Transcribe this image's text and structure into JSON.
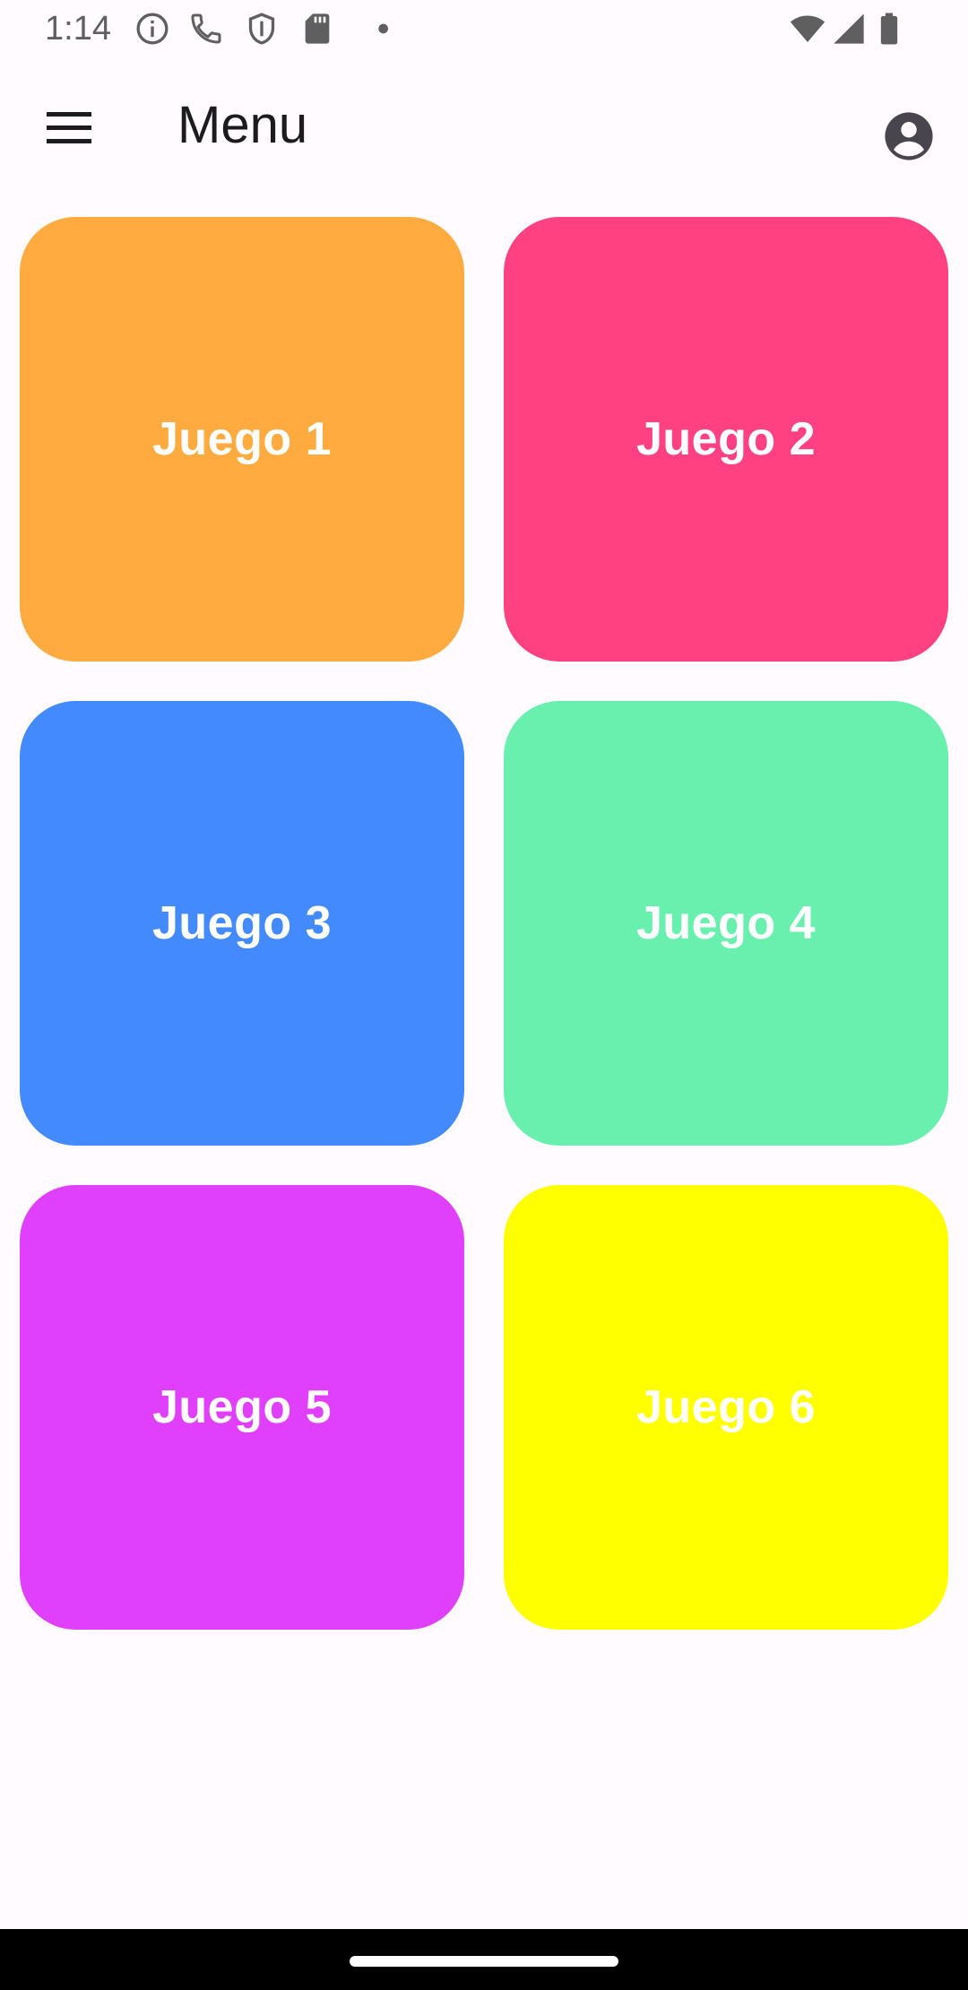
{
  "status_bar": {
    "time": "1:14",
    "left_icons": [
      "info-icon",
      "phone-icon",
      "shield-icon",
      "sd-card-icon",
      "dot-icon"
    ],
    "right_icons": [
      "wifi-icon",
      "signal-icon",
      "battery-icon"
    ]
  },
  "app_bar": {
    "title": "Menu",
    "menu_icon": "hamburger-menu-icon",
    "account_icon": "account-circle-icon"
  },
  "tiles": [
    {
      "label": "Juego 1",
      "color": "#ffab40"
    },
    {
      "label": "Juego 2",
      "color": "#ff4081"
    },
    {
      "label": "Juego 3",
      "color": "#448aff"
    },
    {
      "label": "Juego 4",
      "color": "#69f0ae"
    },
    {
      "label": "Juego 5",
      "color": "#e040fb"
    },
    {
      "label": "Juego 6",
      "color": "#ffff00"
    }
  ],
  "colors": {
    "background": "#fffbfe",
    "status_icons": "#5f5f5f",
    "title_text": "#1c1b1f",
    "tile_text": "#ffffff",
    "nav_bar": "#000000"
  }
}
